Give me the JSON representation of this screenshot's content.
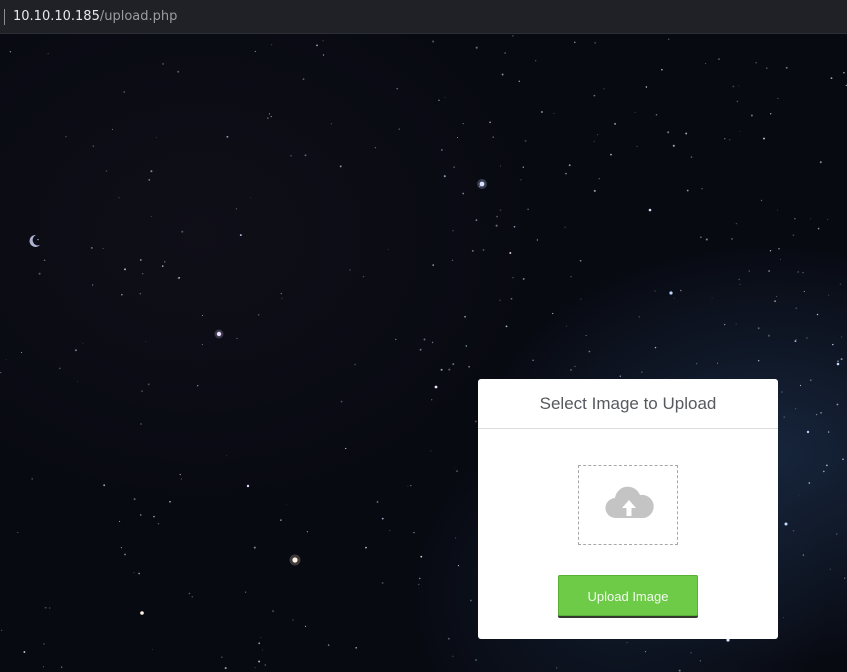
{
  "browser": {
    "url_host": "10.10.10.185",
    "url_path": "/upload.php"
  },
  "upload_card": {
    "title": "Select Image to Upload",
    "drop_zone_icon": "cloud-upload-icon",
    "button_label": "Upload Image"
  },
  "colors": {
    "button_green": "#6dcb47",
    "card_background": "#ffffff",
    "page_background": "#07090f"
  }
}
